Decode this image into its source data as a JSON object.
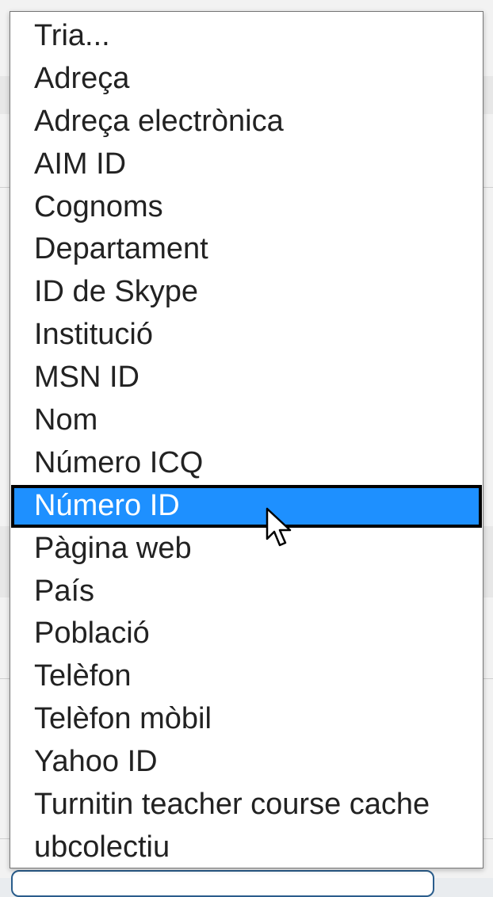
{
  "dropdown": {
    "options": [
      {
        "label": "Tria..."
      },
      {
        "label": "Adreça"
      },
      {
        "label": "Adreça electrònica"
      },
      {
        "label": "AIM ID"
      },
      {
        "label": "Cognoms"
      },
      {
        "label": "Departament"
      },
      {
        "label": "ID de Skype"
      },
      {
        "label": "Institució"
      },
      {
        "label": "MSN ID"
      },
      {
        "label": "Nom"
      },
      {
        "label": "Número ICQ"
      },
      {
        "label": "Número ID"
      },
      {
        "label": "Pàgina web"
      },
      {
        "label": "País"
      },
      {
        "label": "Població"
      },
      {
        "label": "Telèfon"
      },
      {
        "label": "Telèfon mòbil"
      },
      {
        "label": "Yahoo ID"
      },
      {
        "label": "Turnitin teacher course cache"
      },
      {
        "label": "ubcolectiu"
      }
    ],
    "highlighted_label": "Número ID"
  },
  "colors": {
    "highlight_bg": "#1e90ff",
    "highlight_text": "#ffffff",
    "option_text": "#222222",
    "border": "#767676"
  },
  "icons": {
    "cursor": "mouse-pointer-icon"
  }
}
